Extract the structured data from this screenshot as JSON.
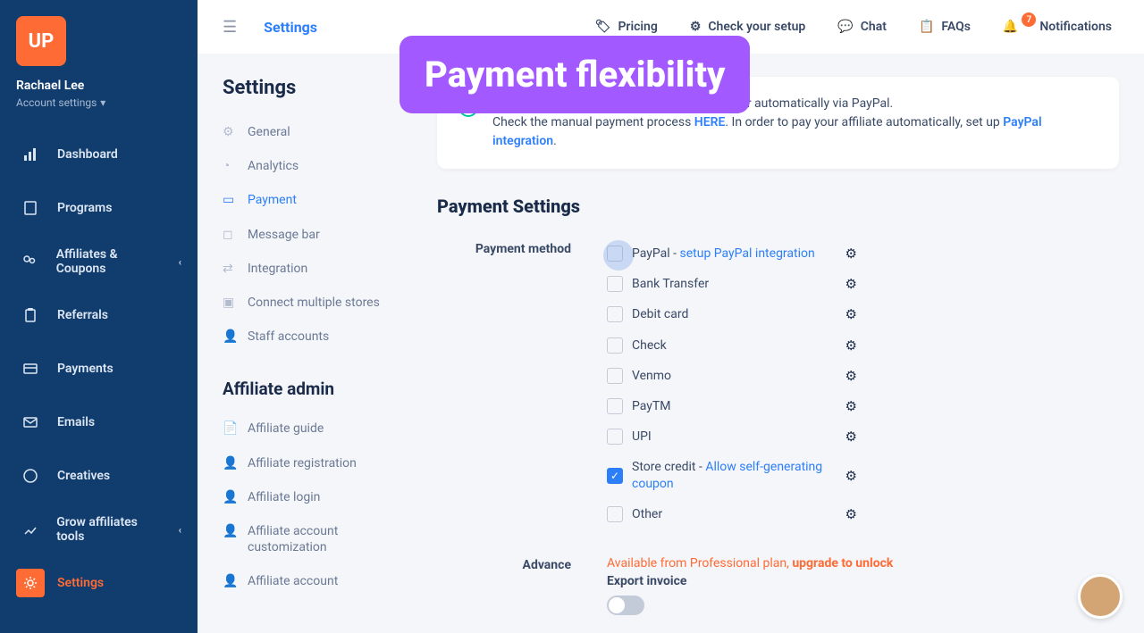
{
  "logo_text": "UP",
  "user": {
    "name": "Rachael Lee",
    "account_link": "Account settings"
  },
  "sidebar_items": [
    {
      "label": "Dashboard",
      "icon": "bar-chart"
    },
    {
      "label": "Programs",
      "icon": "document"
    },
    {
      "label": "Affiliates & Coupons",
      "icon": "users",
      "chevron": true
    },
    {
      "label": "Referrals",
      "icon": "clipboard"
    },
    {
      "label": "Payments",
      "icon": "credit-card"
    },
    {
      "label": "Emails",
      "icon": "mail"
    },
    {
      "label": "Creatives",
      "icon": "smile"
    },
    {
      "label": "Grow affiliates tools",
      "icon": "growth",
      "chevron": true
    },
    {
      "label": "Settings",
      "icon": "gear",
      "active": true
    }
  ],
  "topbar": {
    "title": "Settings",
    "items": [
      {
        "label": "Pricing",
        "icon": "tag"
      },
      {
        "label": "Check your setup",
        "icon": "check-setup"
      },
      {
        "label": "Chat",
        "icon": "chat"
      },
      {
        "label": "FAQs",
        "icon": "faq"
      },
      {
        "label": "Notifications",
        "icon": "bell",
        "badge": "7"
      }
    ]
  },
  "settings_menu": {
    "heading": "Settings",
    "items": [
      {
        "label": "General"
      },
      {
        "label": "Analytics"
      },
      {
        "label": "Payment",
        "active": true
      },
      {
        "label": "Message bar"
      },
      {
        "label": "Integration"
      },
      {
        "label": "Connect multiple stores"
      },
      {
        "label": "Staff accounts"
      }
    ],
    "affiliate_heading": "Affiliate admin",
    "affiliate_items": [
      {
        "label": "Affiliate guide"
      },
      {
        "label": "Affiliate registration"
      },
      {
        "label": "Affiliate login"
      },
      {
        "label": "Affiliate account customization"
      },
      {
        "label": "Affiliate account"
      }
    ]
  },
  "info_box": {
    "line1": "The payment process can be done manually or automatically via PayPal.",
    "line2a": "Check the manual payment process ",
    "here": "HERE",
    "line2b": ". In order to pay your affiliate automatically, set up ",
    "paypal_link": "PayPal integration",
    "dot": "."
  },
  "panel": {
    "title": "Payment Settings",
    "method_label": "Payment method",
    "advance_label": "Advance",
    "methods": [
      {
        "name": "PayPal",
        "extra": " - ",
        "link": "setup PayPal integration",
        "checked": false,
        "pulse": true
      },
      {
        "name": "Bank Transfer",
        "checked": false
      },
      {
        "name": "Debit card",
        "checked": false
      },
      {
        "name": "Check",
        "checked": false
      },
      {
        "name": "Venmo",
        "checked": false
      },
      {
        "name": "PayTM",
        "checked": false
      },
      {
        "name": "UPI",
        "checked": false
      },
      {
        "name": "Store credit",
        "extra": " - ",
        "link": "Allow self-generating coupon",
        "checked": true
      },
      {
        "name": "Other",
        "checked": false
      }
    ],
    "advance": {
      "available": "Available from Professional plan, ",
      "upgrade": "upgrade to unlock",
      "export": "Export invoice",
      "toggle_off": "OFF"
    }
  },
  "promo": "Payment flexibility"
}
